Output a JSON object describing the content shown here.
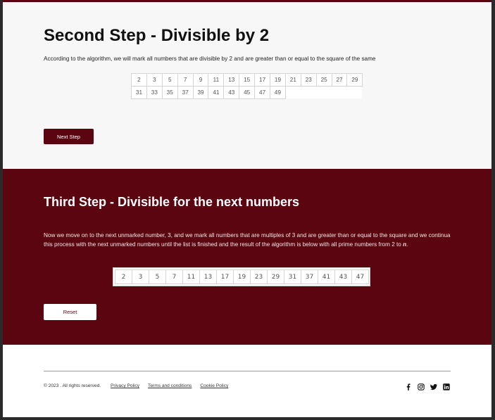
{
  "step2": {
    "title": "Second Step - Divisible by 2",
    "description": "According to the algorithm, we will mark all numbers that are divisible by 2 and are greater than or equal to the square of the same",
    "numbers": [
      "2",
      "3",
      "5",
      "7",
      "9",
      "11",
      "13",
      "15",
      "17",
      "19",
      "21",
      "23",
      "25",
      "27",
      "29",
      "31",
      "33",
      "35",
      "37",
      "39",
      "41",
      "43",
      "45",
      "47",
      "49"
    ],
    "next_button": "Next Step"
  },
  "step3": {
    "title": "Third Step - Divisible for the next numbers",
    "description_before": "Now we move on to the next unmarked number, 3, and we mark all numbers that are multiples of 3 and are greater than or equal to the square and we continua this process with the next unmarked numbers until the list is finished and the result of the algorithm is below with all prime numbers from 2 to ",
    "description_var": "n",
    "description_after": ".",
    "primes": [
      "2",
      "3",
      "5",
      "7",
      "11",
      "13",
      "17",
      "19",
      "23",
      "29",
      "31",
      "37",
      "41",
      "43",
      "47"
    ],
    "reset_button": "Reset"
  },
  "footer": {
    "copyright": "© 2023 . All rights reserved.",
    "links": [
      "Privacy Policy",
      "Terms and conditions",
      "Cookie Policy"
    ],
    "social_icons": [
      "facebook-icon",
      "instagram-icon",
      "twitter-icon",
      "linkedin-icon"
    ]
  },
  "colors": {
    "accent": "#5a0510",
    "background": "#f7f7f7"
  }
}
